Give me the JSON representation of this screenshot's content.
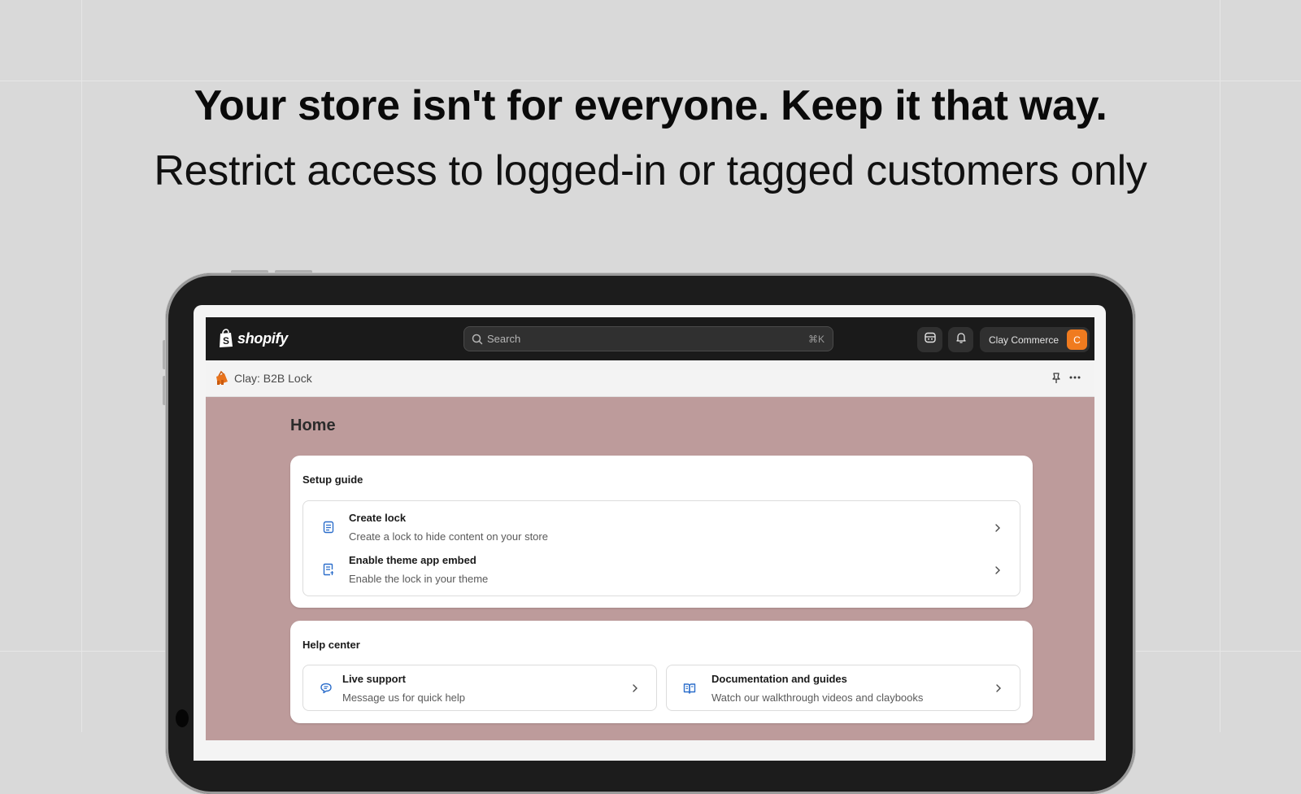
{
  "hero": {
    "title": "Your store isn't for everyone. Keep it that way.",
    "subtitle": "Restrict access to logged-in or tagged customers only"
  },
  "topbar": {
    "logo_text": "shopify",
    "search_placeholder": "Search",
    "search_shortcut": "⌘K",
    "store_name": "Clay Commerce",
    "avatar_initial": "C"
  },
  "app": {
    "title": "Clay: B2B Lock"
  },
  "page": {
    "title": "Home"
  },
  "setup_guide": {
    "title": "Setup guide",
    "items": [
      {
        "title": "Create lock",
        "subtitle": "Create a lock to hide content on your store",
        "icon": "note-icon"
      },
      {
        "title": "Enable theme app embed",
        "subtitle": "Enable the lock in your theme",
        "icon": "theme-embed-icon"
      }
    ]
  },
  "help_center": {
    "title": "Help center",
    "items": [
      {
        "title": "Live support",
        "subtitle": "Message us for quick help",
        "icon": "chat-icon"
      },
      {
        "title": "Documentation and guides",
        "subtitle": "Watch our walkthrough videos and claybooks",
        "icon": "book-icon"
      }
    ]
  },
  "colors": {
    "background": "#d9d9d9",
    "app_canvas": "#bd9b9b",
    "topbar": "#1a1a1a",
    "accent_icon": "#2c6ecb",
    "avatar": "#f07b1f"
  }
}
